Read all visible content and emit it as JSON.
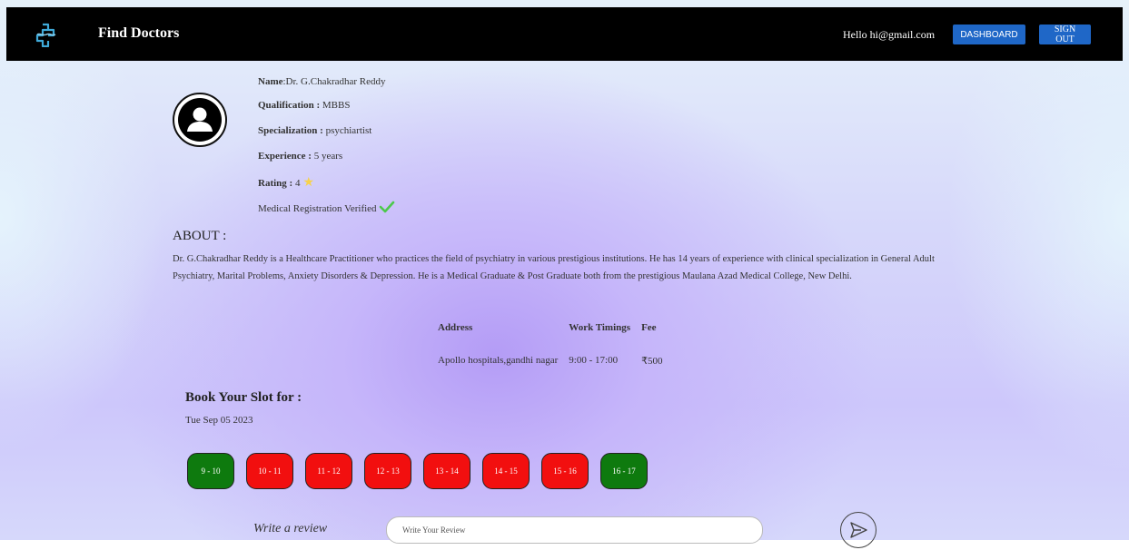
{
  "header": {
    "brand": "Find Doctors",
    "greeting": "Hello hi@gmail.com",
    "dashboard_label": "DASHBOARD",
    "signout_label": "SIGN OUT"
  },
  "doctor": {
    "name_label": "Name",
    "name": ":Dr. G.Chakradhar Reddy",
    "qualification_label": "Qualification :",
    "qualification": " MBBS",
    "specialization_label": "Specialization :",
    "specialization": " psychiartist",
    "experience_label": "Experience :",
    "experience": " 5 years",
    "rating_label": "Rating :",
    "rating": " 4",
    "verified": "Medical Registration Verified"
  },
  "about": {
    "title": "ABOUT :",
    "text": "Dr. G.Chakradhar Reddy is a Healthcare Practitioner who practices the field of psychiatry in various prestigious institutions. He has 14 years of experience with clinical specialization in General Adult Psychiatry, Marital Problems, Anxiety Disorders & Depression. He is a Medical Graduate & Post Graduate both from the prestigious Maulana Azad Medical College, New Delhi."
  },
  "details": {
    "headers": [
      "Address",
      "Work Timings",
      "Fee"
    ],
    "row": [
      "Apollo hospitals,gandhi nagar",
      "9:00 - 17:00",
      "₹500"
    ]
  },
  "booking": {
    "title": "Book Your Slot for :",
    "date": "Tue Sep 05 2023",
    "slots": [
      {
        "label": "9 - 10",
        "status": "available"
      },
      {
        "label": "10 - 11",
        "status": "booked"
      },
      {
        "label": "11 - 12",
        "status": "booked"
      },
      {
        "label": "12 - 13",
        "status": "booked"
      },
      {
        "label": "13 - 14",
        "status": "booked"
      },
      {
        "label": "14 - 15",
        "status": "booked"
      },
      {
        "label": "15 - 16",
        "status": "booked"
      },
      {
        "label": "16 - 17",
        "status": "available"
      }
    ]
  },
  "review": {
    "label": "Write a review",
    "placeholder": "Write Your Review",
    "send_icon": "send-icon"
  },
  "colors": {
    "header_bg": "#000000",
    "button_blue": "#1f67c7",
    "slot_available": "#0e7a0e",
    "slot_booked": "#f20f0f",
    "verified_check": "#4cc94c",
    "star": "#f7d24a"
  }
}
